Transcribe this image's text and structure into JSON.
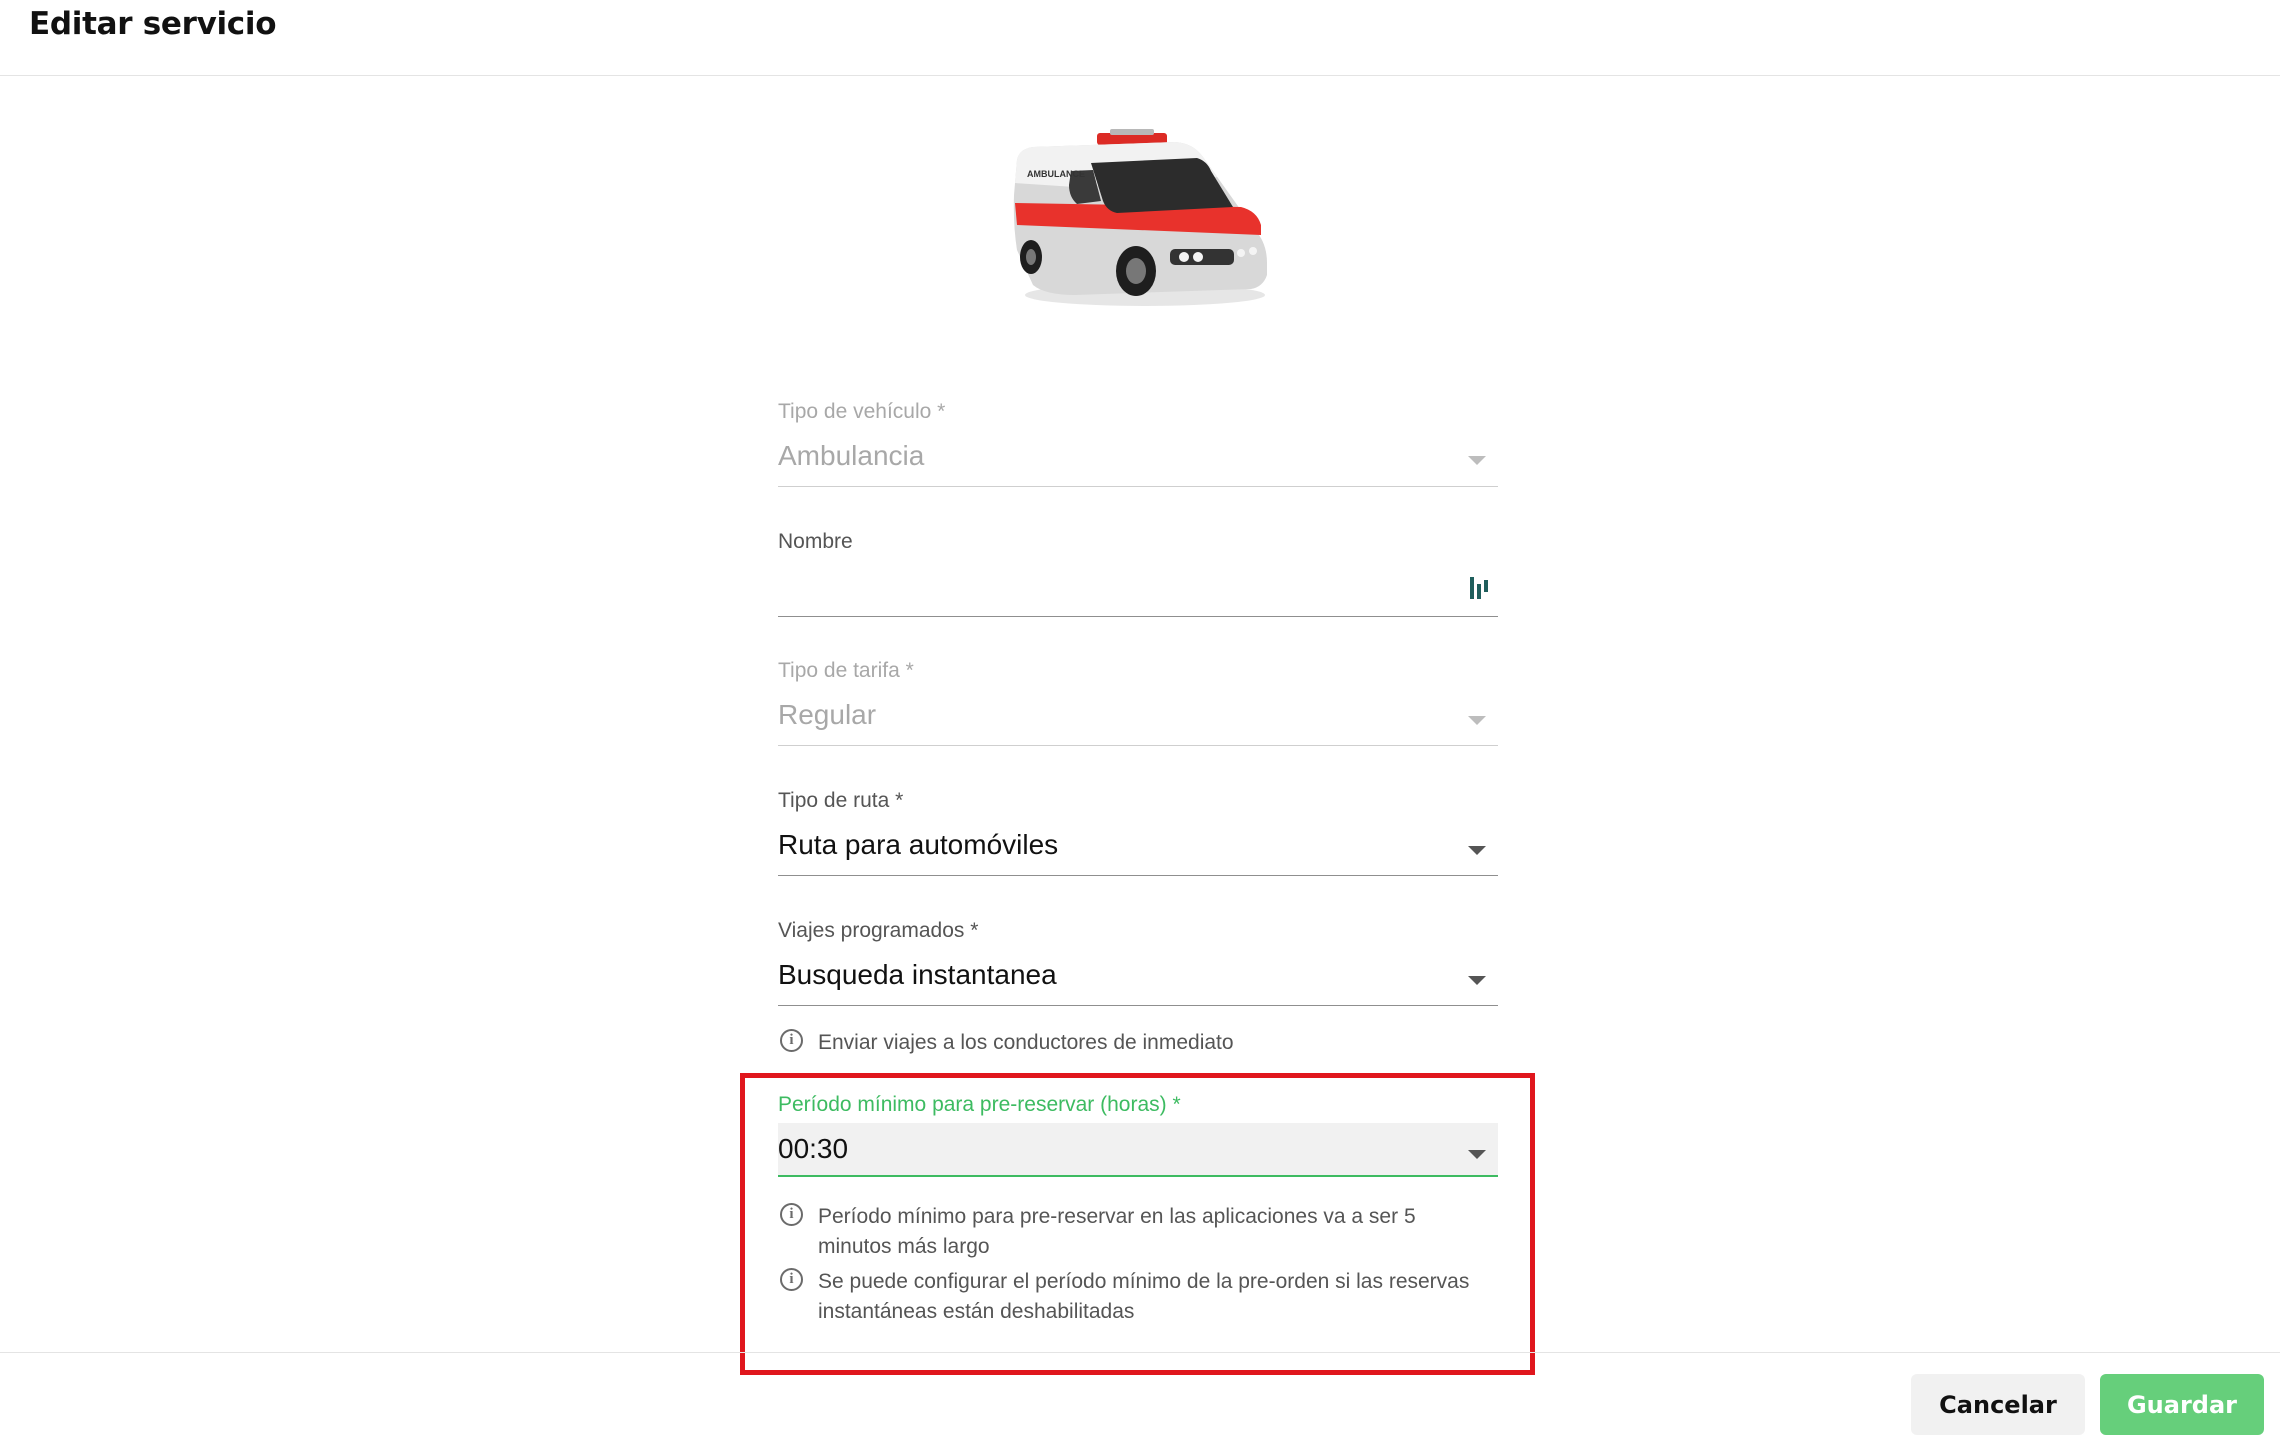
{
  "header": {
    "title": "Editar servicio"
  },
  "vehicle_image": {
    "body_text": "AMBULANCE"
  },
  "form": {
    "vehicle_type": {
      "label": "Tipo de vehículo *",
      "value": "Ambulancia",
      "disabled": true
    },
    "name": {
      "label": "Nombre",
      "value": "",
      "icon": "password-manager-icon"
    },
    "tariff_type": {
      "label": "Tipo de tarifa *",
      "value": "Regular",
      "disabled": true
    },
    "route_type": {
      "label": "Tipo de ruta *",
      "value": "Ruta para automóviles"
    },
    "scheduled_trips": {
      "label": "Viajes programados *",
      "value": "Busqueda instantanea",
      "hint": "Enviar viajes a los conductores de inmediato"
    },
    "min_preorder": {
      "label": "Período mínimo para pre-reservar (horas) *",
      "value": "00:30",
      "hints": [
        "Período mínimo para pre-reservar en las aplicaciones va a ser 5 minutos más largo",
        "Se puede configurar el período mínimo de la pre-orden si las reservas instantáneas están deshabilitadas"
      ]
    }
  },
  "footer": {
    "cancel_label": "Cancelar",
    "save_label": "Guardar"
  },
  "colors": {
    "accent": "#3dbb61",
    "save_button": "#66cf7b",
    "highlight_border": "#e0161d",
    "ambulance_stripe": "#e8322c"
  }
}
